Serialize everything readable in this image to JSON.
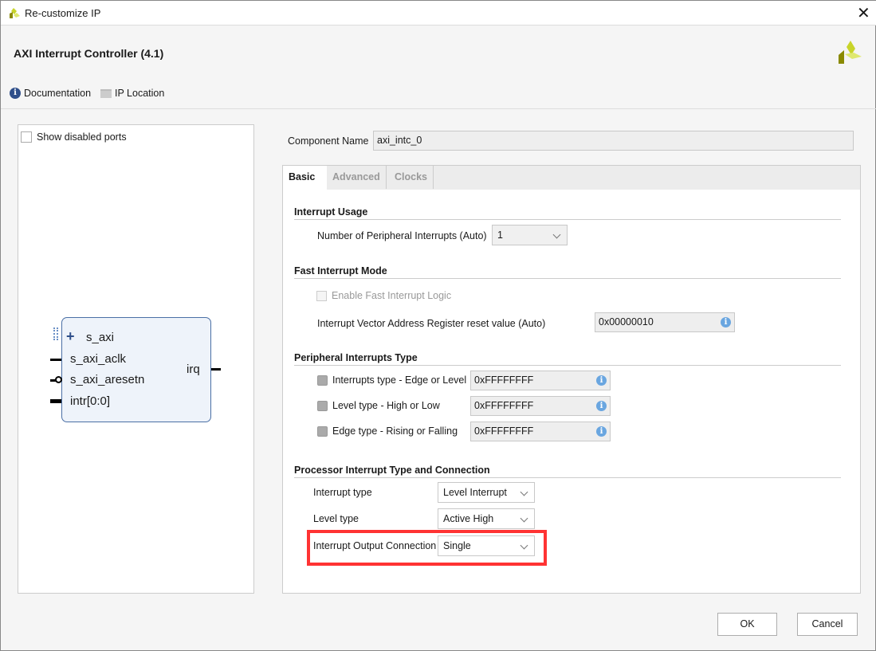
{
  "window": {
    "title": "Re-customize IP",
    "close_icon": "close-icon"
  },
  "header": {
    "title": "AXI Interrupt Controller (4.1)",
    "documentation": "Documentation",
    "ip_location": "IP Location"
  },
  "left_panel": {
    "show_disabled_ports": "Show disabled ports",
    "show_disabled_checked": false,
    "block": {
      "ports_left": [
        "s_axi",
        "s_axi_aclk",
        "s_axi_aresetn",
        "intr[0:0]"
      ],
      "ports_right": [
        "irq"
      ]
    }
  },
  "component": {
    "label": "Component Name",
    "value": "axi_intc_0"
  },
  "tabs": [
    {
      "label": "Basic",
      "active": true
    },
    {
      "label": "Advanced"
    },
    {
      "label": "Clocks"
    }
  ],
  "basic": {
    "interrupt_usage": {
      "title": "Interrupt Usage",
      "num_label": "Number of Peripheral Interrupts (Auto)",
      "num_value": "1"
    },
    "fast": {
      "title": "Fast Interrupt Mode",
      "enable_label": "Enable Fast Interrupt Logic",
      "enable_checked": false,
      "ivar_label": "Interrupt Vector Address Register reset value (Auto)",
      "ivar_value": "0x00000010"
    },
    "peripheral": {
      "title": "Peripheral Interrupts Type",
      "rows": [
        {
          "label": "Interrupts type - Edge or Level",
          "value": "0xFFFFFFFF"
        },
        {
          "label": "Level type - High or Low",
          "value": "0xFFFFFFFF"
        },
        {
          "label": "Edge type - Rising or Falling",
          "value": "0xFFFFFFFF"
        }
      ]
    },
    "processor": {
      "title": "Processor Interrupt Type and Connection",
      "rows": [
        {
          "label": "Interrupt type",
          "value": "Level Interrupt"
        },
        {
          "label": "Level type",
          "value": "Active High"
        },
        {
          "label": "Interrupt Output Connection",
          "value": "Single"
        }
      ]
    }
  },
  "highlight_color": "#ff3333",
  "footer": {
    "ok": "OK",
    "cancel": "Cancel"
  }
}
